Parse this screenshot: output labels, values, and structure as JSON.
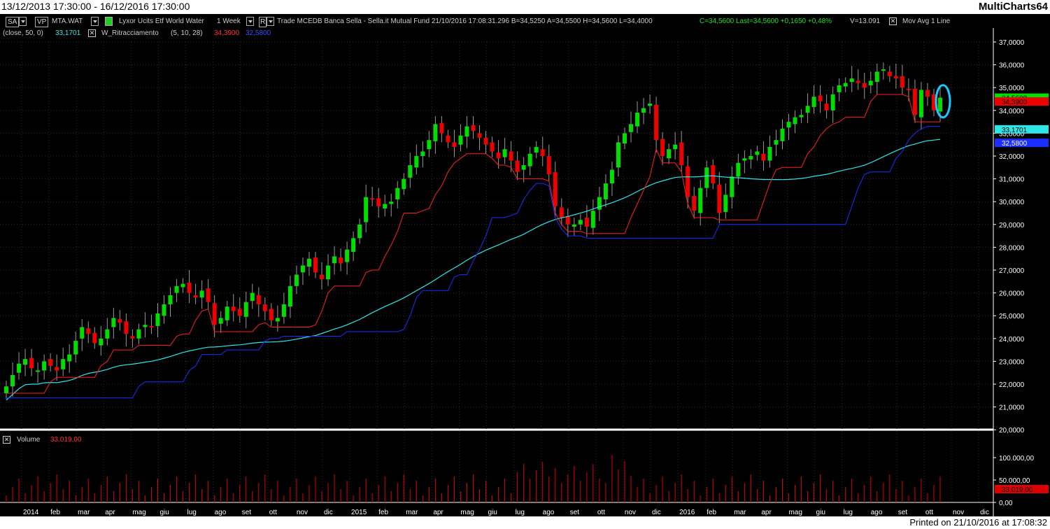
{
  "window": {
    "date_range": "13/12/2013 17:30:00 - 16/12/2016 17:30:00",
    "app_name": "MultiCharts64"
  },
  "toolbar": {
    "sa_label": "SA",
    "vp_label": "VP",
    "symbol": "MTA.WAT",
    "instrument": "Lyxor Ucits Etf World Water",
    "interval": "1 Week",
    "r_label": "R",
    "quote_line": "Trade  MCEDB  Banca Sella - Sella.it  Mutual Fund  21/10/2016  17:08:31.296  B=34,5250  A=34,5500  H=34,5600  L=34,4000",
    "close_info": "C=34,5600  Last=34,5600  +0,1650  +0,48%",
    "volume_info": "V=13.091",
    "study": "Mov Avg 1 Line"
  },
  "indicators": {
    "ma_params": "(close,  50,  0)",
    "ma_value": "33,1701",
    "wr_name": "W_Ritracciamento",
    "wr_params": "(5,  10,  28)",
    "wr_value1": "34,3900",
    "wr_value2": "32,5800",
    "vol_name": "Volume",
    "vol_value": "33.019,00"
  },
  "price_axis": {
    "labels": [
      "37,0000",
      "36,0000",
      "35,0000",
      "34,0000",
      "33,0000",
      "32,0000",
      "31,0000",
      "30,0000",
      "29,0000",
      "28,0000",
      "27,0000",
      "26,0000",
      "25,0000",
      "24,0000",
      "23,0000",
      "22,0000",
      "21,0000",
      "20,0000"
    ],
    "tags": {
      "last": "34,5600",
      "wr_red": "34,3900",
      "ma": "33,1701",
      "wr_blue": "32,5800"
    }
  },
  "volume_axis": {
    "labels": [
      "100.000,00",
      "50.000,00",
      "0,00"
    ],
    "tag": "33.019,00"
  },
  "time_axis": {
    "labels": [
      "2014",
      "feb",
      "mar",
      "apr",
      "mag",
      "giu",
      "lug",
      "ago",
      "set",
      "ott",
      "nov",
      "dic",
      "2015",
      "feb",
      "mar",
      "apr",
      "mag",
      "giu",
      "lug",
      "ago",
      "set",
      "ott",
      "nov",
      "dic",
      "2016",
      "feb",
      "mar",
      "apr",
      "mag",
      "giu",
      "lug",
      "ago",
      "set",
      "ott",
      "nov",
      "dic"
    ]
  },
  "colors": {
    "up": "#00dd00",
    "down": "#ee0000",
    "ma": "#2ee6e6",
    "wr_red": "#ff2020",
    "wr_blue": "#1a2fff",
    "grid": "#2c2c2c",
    "axis": "#ffffff",
    "highlight": "#19c8ff"
  },
  "chart_data": {
    "type": "candlestick",
    "title": "MTA.WAT",
    "ylim": [
      20,
      37.5
    ],
    "x_range": [
      "2013-12-13",
      "2016-12-16"
    ],
    "close": [
      21.9,
      22.4,
      22.9,
      23.1,
      22.7,
      22.6,
      23.0,
      22.8,
      22.6,
      23.1,
      23.3,
      23.9,
      24.5,
      24.2,
      23.8,
      24.0,
      24.4,
      24.9,
      24.7,
      24.2,
      24.0,
      24.4,
      24.6,
      24.5,
      25.1,
      25.5,
      25.9,
      26.3,
      26.4,
      26.0,
      25.8,
      26.1,
      25.6,
      24.6,
      24.9,
      25.4,
      25.2,
      25.0,
      25.6,
      26.0,
      25.5,
      25.2,
      24.8,
      24.9,
      25.5,
      26.3,
      26.8,
      27.2,
      27.5,
      26.9,
      26.6,
      27.2,
      27.6,
      27.3,
      27.9,
      28.4,
      29.0,
      30.2,
      30.1,
      29.8,
      29.9,
      30.0,
      30.6,
      31.0,
      31.6,
      32.0,
      32.2,
      32.7,
      33.4,
      33.0,
      32.6,
      32.4,
      32.9,
      33.3,
      33.1,
      32.8,
      32.5,
      32.2,
      31.9,
      32.3,
      31.8,
      31.3,
      31.6,
      32.1,
      32.4,
      32.0,
      31.2,
      29.8,
      29.3,
      29.0,
      29.0,
      29.2,
      28.9,
      29.6,
      30.2,
      30.8,
      31.4,
      32.6,
      33.0,
      33.4,
      33.9,
      34.1,
      34.3,
      32.7,
      32.0,
      32.3,
      32.5,
      31.6,
      30.2,
      29.6,
      30.6,
      31.5,
      30.8,
      29.5,
      30.3,
      31.1,
      31.7,
      31.9,
      32.0,
      32.2,
      31.8,
      32.4,
      32.7,
      33.2,
      33.5,
      33.7,
      33.8,
      34.2,
      34.6,
      34.4,
      34.0,
      34.7,
      35.1,
      35.2,
      35.4,
      35.2,
      35.0,
      35.3,
      35.7,
      35.8,
      35.5,
      35.4,
      35.0,
      34.9,
      33.8,
      34.9,
      34.6,
      34.0,
      34.56
    ]
  }
}
